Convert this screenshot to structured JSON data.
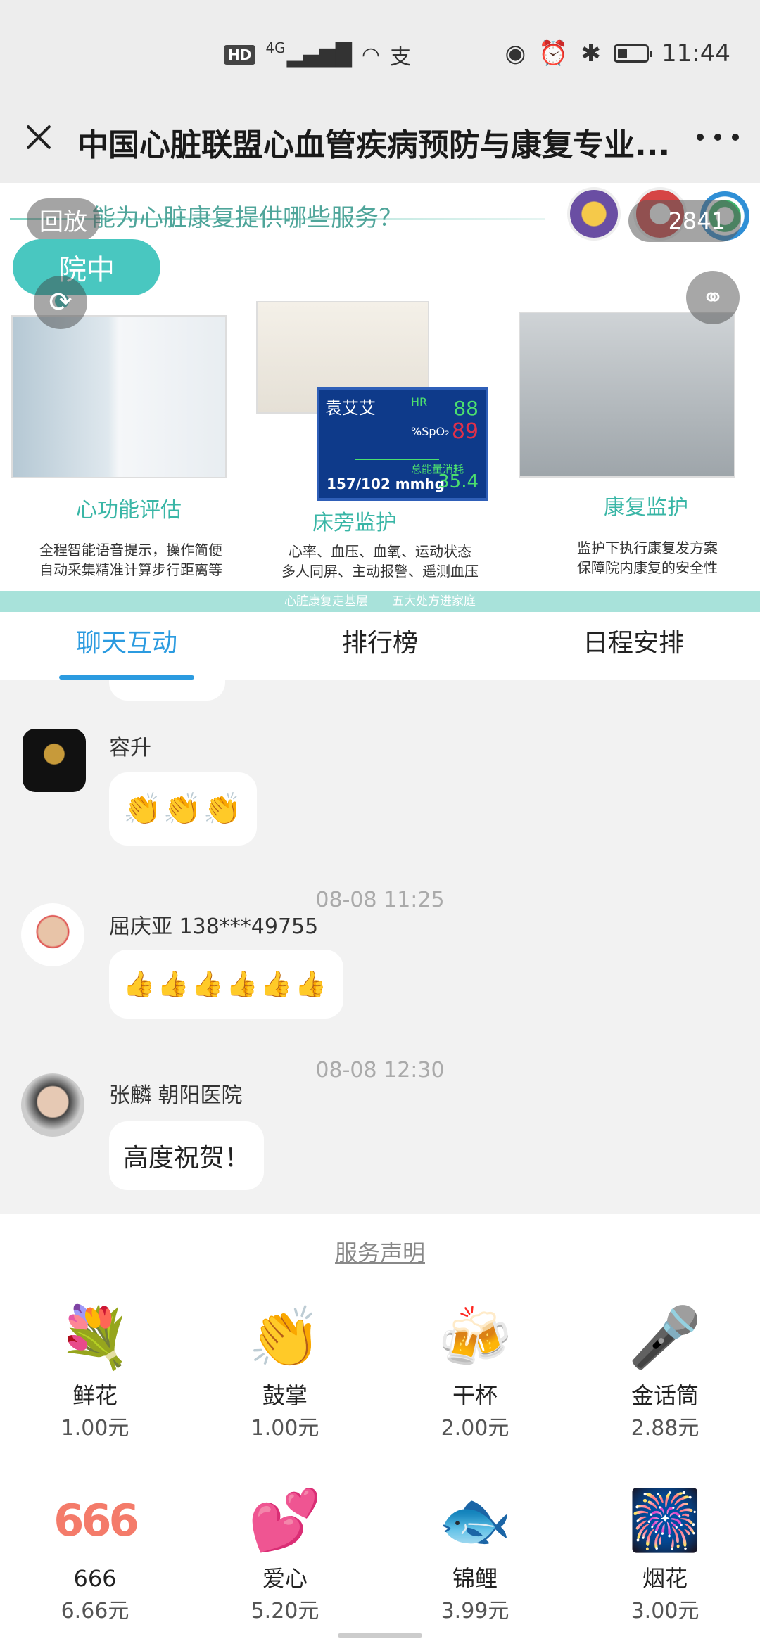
{
  "status_bar": {
    "hd": "HD",
    "network": "4G",
    "right_icons": [
      "eye-icon",
      "alarm-icon",
      "bluetooth-icon",
      "battery-icon"
    ],
    "battery_level": 0.35,
    "time": "11:44"
  },
  "nav": {
    "title": "中国心脏联盟心血管疾病预防与康复专业..."
  },
  "video": {
    "replay": "回放",
    "viewers": "2841",
    "heading": "能为心脏康复提供哪些服务？",
    "cloud": "院中",
    "monitor": {
      "name": "袁艾艾",
      "hr_label": "HR",
      "hr": "88",
      "spo2_label": "%SpO₂",
      "spo2": "89",
      "energy_label": "总能量消耗",
      "energy": "35.4",
      "bp": "157/102 mmhg"
    },
    "features": [
      {
        "title": "心功能评估",
        "desc1": "全程智能语音提示，操作简便",
        "desc2": "自动采集精准计算步行距离等"
      },
      {
        "title": "床旁监护",
        "desc1": "心率、血压、血氧、运动状态",
        "desc2": "多人同屏、主动报警、遥测血压"
      },
      {
        "title": "康复监护",
        "desc1": "监护下执行康复发方案",
        "desc2": "保障院内康复的安全性"
      }
    ],
    "footer": "心脏康复走基层　　五大处方进家庭"
  },
  "tabs": [
    "聊天互动",
    "排行榜",
    "日程安排"
  ],
  "chat": {
    "messages": [
      {
        "sender": "容升",
        "content": "👏👏👏"
      },
      {
        "timestamp": "08-08 11:25",
        "sender": "屈庆亚 138***49755",
        "content": "👍👍👍👍👍👍"
      },
      {
        "timestamp": "08-08 12:30",
        "sender": "张麟 朝阳医院",
        "content": "高度祝贺！"
      }
    ]
  },
  "gifts": {
    "service_link": "服务声明",
    "items": [
      {
        "name": "鲜花",
        "price": "1.00元",
        "icon": "flower-bouquet-icon"
      },
      {
        "name": "鼓掌",
        "price": "1.00元",
        "icon": "clapping-hands-icon"
      },
      {
        "name": "干杯",
        "price": "2.00元",
        "icon": "beer-mugs-icon"
      },
      {
        "name": "金话筒",
        "price": "2.88元",
        "icon": "golden-microphone-icon"
      },
      {
        "name": "666",
        "price": "6.66元",
        "icon": "666-icon"
      },
      {
        "name": "爱心",
        "price": "5.20元",
        "icon": "hearts-icon"
      },
      {
        "name": "锦鲤",
        "price": "3.99元",
        "icon": "koi-fish-icon"
      },
      {
        "name": "烟花",
        "price": "3.00元",
        "icon": "fireworks-icon"
      }
    ]
  }
}
